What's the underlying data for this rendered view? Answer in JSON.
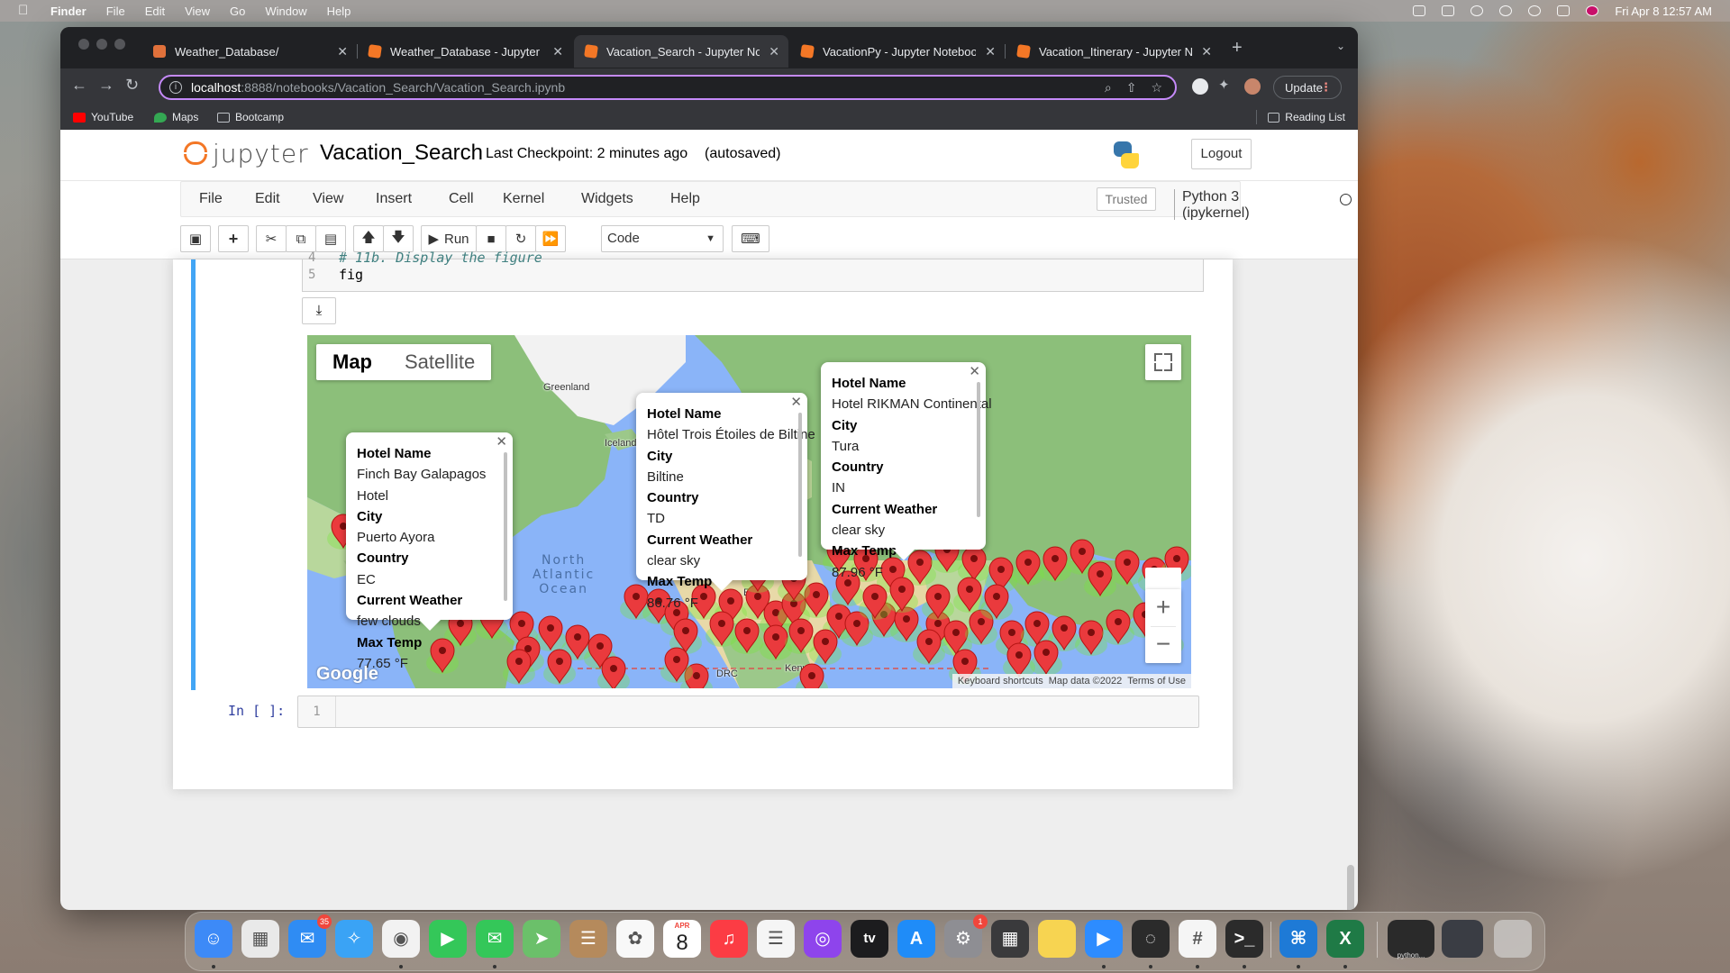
{
  "menubar": {
    "app": "Finder",
    "items": [
      "File",
      "Edit",
      "View",
      "Go",
      "Window",
      "Help"
    ],
    "clock": "Fri Apr 8  12:57 AM"
  },
  "browser": {
    "tabs": [
      {
        "label": "Weather_Database/",
        "icon": "jupyter-icon",
        "active": false
      },
      {
        "label": "Weather_Database - Jupyter N",
        "icon": "notebook-icon",
        "active": false
      },
      {
        "label": "Vacation_Search - Jupyter Not",
        "icon": "notebook-icon",
        "active": true
      },
      {
        "label": "VacationPy - Jupyter Notebook",
        "icon": "notebook-icon",
        "active": false
      },
      {
        "label": "Vacation_Itinerary - Jupyter N",
        "icon": "notebook-icon",
        "active": false
      }
    ],
    "url_host": "localhost",
    "url_path": ":8888/notebooks/Vacation_Search/Vacation_Search.ipynb",
    "update_label": "Update",
    "bookmarks": [
      "YouTube",
      "Maps",
      "Bootcamp"
    ],
    "reading_list": "Reading List"
  },
  "jupyter": {
    "logo_text": "jupyter",
    "notebook_name": "Vacation_Search",
    "checkpoint": "Last Checkpoint: 2 minutes ago",
    "autosave": "(autosaved)",
    "logout": "Logout",
    "menu": [
      "File",
      "Edit",
      "View",
      "Insert",
      "Cell",
      "Kernel",
      "Widgets",
      "Help"
    ],
    "trusted": "Trusted",
    "kernel": "Python 3 (ipykernel)",
    "run_label": "Run",
    "cell_type": "Code"
  },
  "cell": {
    "lines": [
      {
        "no": "4",
        "text": "# 11b. Display the figure",
        "comment": true
      },
      {
        "no": "5",
        "text": "fig",
        "comment": false
      }
    ]
  },
  "map": {
    "type_buttons": [
      "Map",
      "Satellite"
    ],
    "labels": {
      "greenland": "Greenland",
      "iceland": "Iceland",
      "ocean": "North\nAtlantic\nOcean",
      "egypt": "Egypt",
      "drc": "DRC",
      "kenya": "Kenya"
    },
    "google": "Google",
    "attribution": [
      "Keyboard shortcuts",
      "Map data ©2022",
      "Terms of Use"
    ],
    "info_windows": [
      {
        "hotel_label": "Hotel Name",
        "hotel": "Finch Bay Galapagos Hotel",
        "city_label": "City",
        "city": "Puerto Ayora",
        "country_label": "Country",
        "country": "EC",
        "weather_label": "Current Weather",
        "weather": "few clouds",
        "temp_label": "Max Temp",
        "temp": "77.65 °F"
      },
      {
        "hotel_label": "Hotel Name",
        "hotel": "Hôtel Trois Étoiles de Biltine",
        "city_label": "City",
        "city": "Biltine",
        "country_label": "Country",
        "country": "TD",
        "weather_label": "Current Weather",
        "weather": "clear sky",
        "temp_label": "Max Temp",
        "temp": "86.76 °F"
      },
      {
        "hotel_label": "Hotel Name",
        "hotel": "Hotel RIKMAN Continental",
        "city_label": "City",
        "city": "Tura",
        "country_label": "Country",
        "country": "IN",
        "weather_label": "Current Weather",
        "weather": "clear sky",
        "temp_label": "Max Temp",
        "temp": "87.96 °F"
      }
    ]
  },
  "next_cell": {
    "prompt": "In [ ]:",
    "line": "1"
  },
  "dock": {
    "apps": [
      "Finder",
      "Launchpad",
      "Mail",
      "Safari",
      "Chrome",
      "FaceTime",
      "Messages",
      "Maps",
      "Contacts",
      "Photos",
      "Calendar",
      "Music",
      "Reminders",
      "Podcasts",
      "TV",
      "App Store",
      "System Preferences",
      "Calculator",
      "Notes",
      "Zoom",
      "Jupyter",
      "Slack",
      "Terminal",
      "VS Code",
      "Excel"
    ],
    "mail_badge": "35",
    "settings_badge": "1",
    "calendar_month": "APR",
    "calendar_day": "8",
    "tv_label": "tv",
    "minimized_label": "python..."
  }
}
